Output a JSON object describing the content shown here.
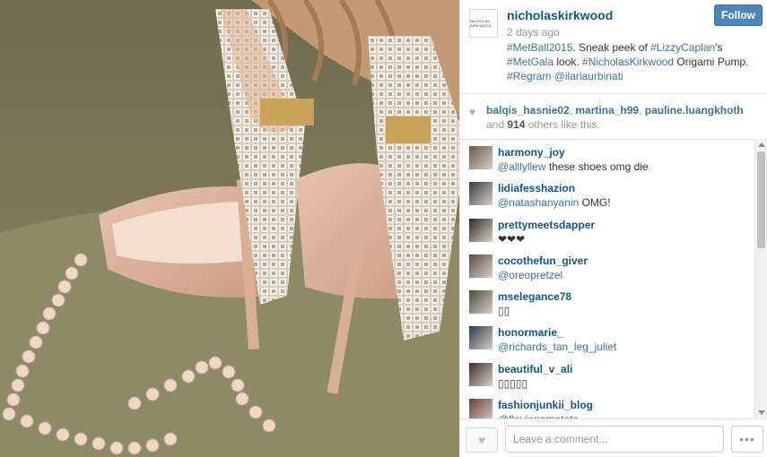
{
  "post": {
    "owner": "nicholaskirkwood",
    "avatar_text": "NICHOLAS KIRKWOOD",
    "time_ago": "2 days ago",
    "follow_label": "Follow",
    "caption": [
      {
        "text": "#MetBall2015",
        "link": true
      },
      {
        "text": ". Sneak peek of ",
        "link": false
      },
      {
        "text": "#LizzyCaplan",
        "link": true
      },
      {
        "text": "'s ",
        "link": false
      },
      {
        "text": "#MetGala",
        "link": true
      },
      {
        "text": " look. ",
        "link": false
      },
      {
        "text": "#NicholasKirkwood",
        "link": true
      },
      {
        "text": " Origami Pump. ",
        "link": false
      },
      {
        "text": "#Regram",
        "link": true
      },
      {
        "text": " ",
        "link": false
      },
      {
        "text": "@ilariaurbinati",
        "link": true
      }
    ]
  },
  "likes": {
    "users": [
      "balqis_hasnie02",
      "martina_h99",
      "pauline.luangkhoth"
    ],
    "sep": ", ",
    "and_text": " and ",
    "count": "914",
    "suffix": " others like this."
  },
  "comments": [
    {
      "user": "harmony_joy",
      "mention": "@alllyllew",
      "text": " these shoes omg die"
    },
    {
      "user": "lidiafesshazion",
      "mention": "@natashanyanin",
      "text": " OMG!"
    },
    {
      "user": "prettymeetsdapper",
      "mention": "",
      "text": "❤❤❤"
    },
    {
      "user": "cocothefun_giver",
      "mention": "@oreopretzel",
      "text": ""
    },
    {
      "user": "mselegance78",
      "mention": "",
      "text": "▯▯"
    },
    {
      "user": "honormarie_",
      "mention": "@richards_tan_leg_juliet",
      "text": ""
    },
    {
      "user": "beautiful_v_ali",
      "mention": "",
      "text": "▯▯▯▯▯"
    },
    {
      "user": "fashionjunkii_blog",
      "mention": "@flavianamatata",
      "text": ""
    }
  ],
  "footer": {
    "comment_placeholder": "Leave a comment...",
    "like_icon": "heart-icon",
    "more_label": "•••"
  }
}
